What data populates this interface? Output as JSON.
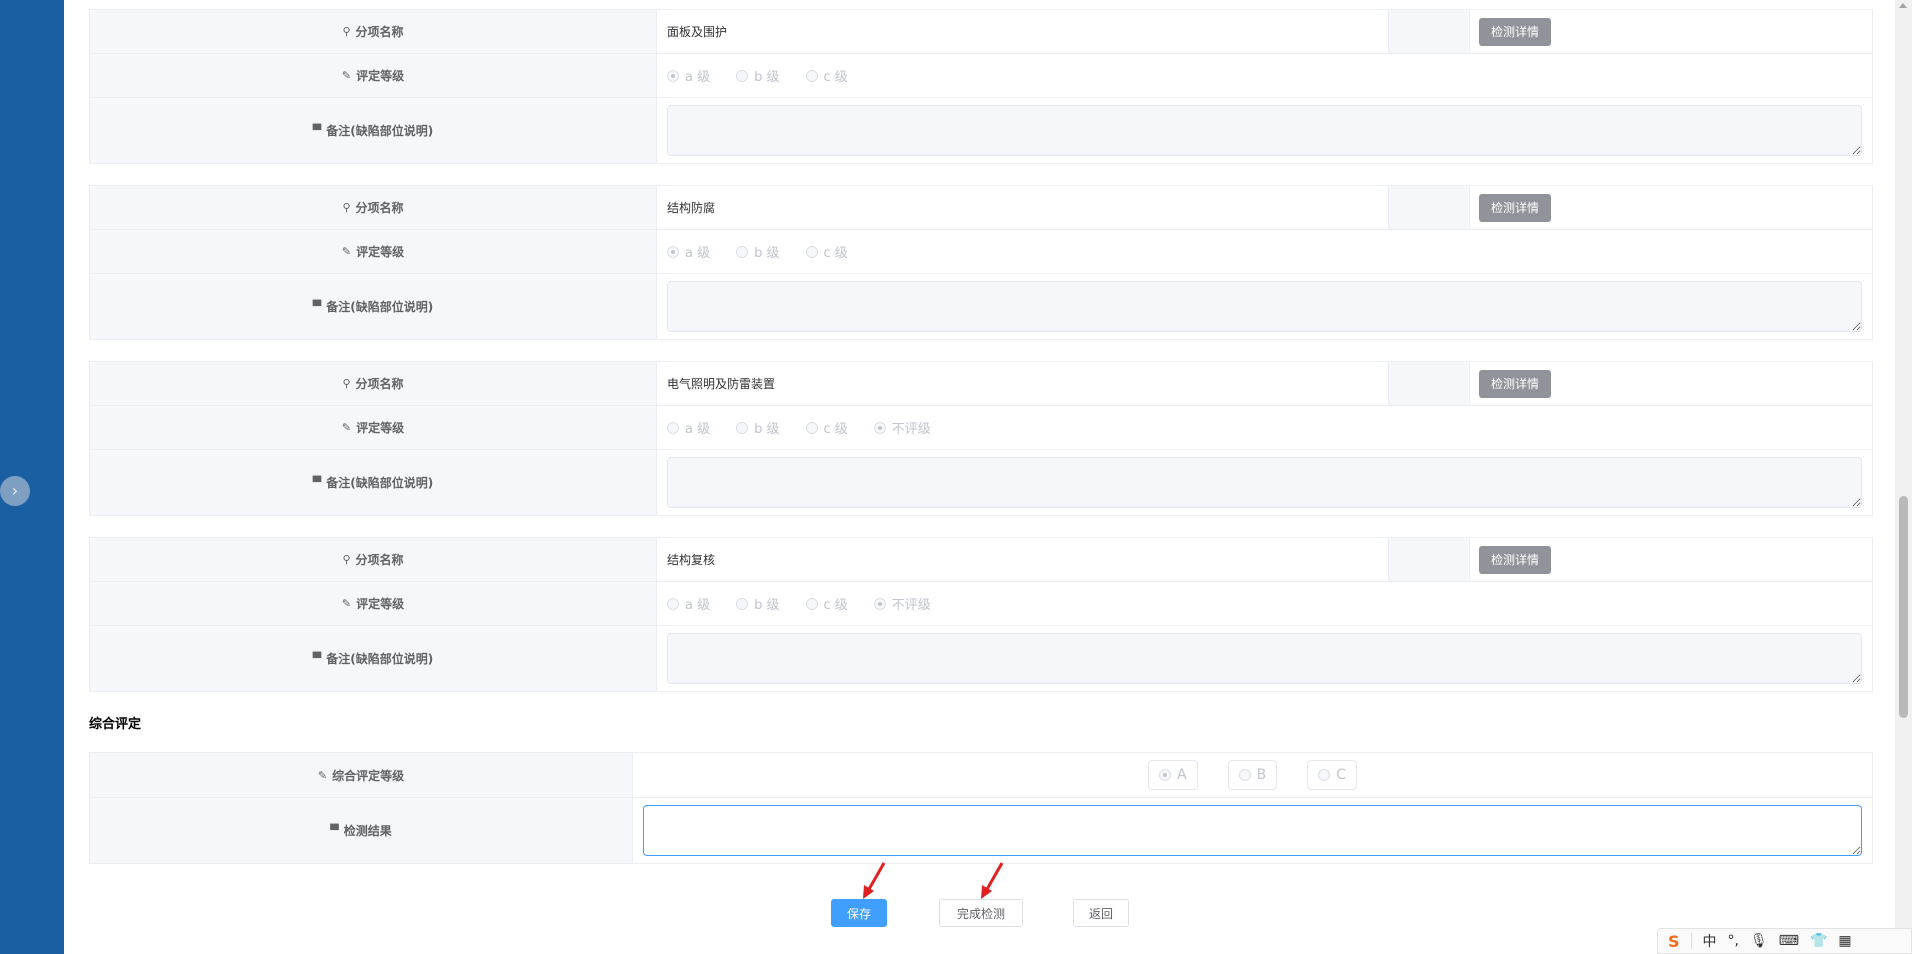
{
  "sections": [
    {
      "name_label": "分项名称",
      "name_value": "面板及围护",
      "detail_button": "检测详情",
      "grade_label": "评定等级",
      "options": [
        {
          "label": "a 级",
          "checked": true
        },
        {
          "label": "b 级",
          "checked": false
        },
        {
          "label": "c 级",
          "checked": false
        }
      ],
      "remark_label": "备注(缺陷部位说明)"
    },
    {
      "name_label": "分项名称",
      "name_value": "结构防腐",
      "detail_button": "检测详情",
      "grade_label": "评定等级",
      "options": [
        {
          "label": "a 级",
          "checked": true
        },
        {
          "label": "b 级",
          "checked": false
        },
        {
          "label": "c 级",
          "checked": false
        }
      ],
      "remark_label": "备注(缺陷部位说明)"
    },
    {
      "name_label": "分项名称",
      "name_value": "电气照明及防雷装置",
      "detail_button": "检测详情",
      "grade_label": "评定等级",
      "options": [
        {
          "label": "a 级",
          "checked": false
        },
        {
          "label": "b 级",
          "checked": false
        },
        {
          "label": "c 级",
          "checked": false
        },
        {
          "label": "不评级",
          "checked": true
        }
      ],
      "remark_label": "备注(缺陷部位说明)"
    },
    {
      "name_label": "分项名称",
      "name_value": "结构复核",
      "detail_button": "检测详情",
      "grade_label": "评定等级",
      "options": [
        {
          "label": "a 级",
          "checked": false
        },
        {
          "label": "b 级",
          "checked": false
        },
        {
          "label": "c 级",
          "checked": false
        },
        {
          "label": "不评级",
          "checked": true
        }
      ],
      "remark_label": "备注(缺陷部位说明)"
    }
  ],
  "summary": {
    "title": "综合评定",
    "grade_label": "综合评定等级",
    "grade_options": [
      {
        "label": "A",
        "checked": true
      },
      {
        "label": "B",
        "checked": false
      },
      {
        "label": "C",
        "checked": false
      }
    ],
    "result_label": "检测结果"
  },
  "actions": {
    "save": "保存",
    "finish": "完成检测",
    "back": "返回"
  },
  "ime": {
    "logo": "S",
    "mode": "中"
  },
  "colors": {
    "sidebar": "#1b5fa3",
    "primary": "#409eff",
    "arrow": "#e02020"
  }
}
